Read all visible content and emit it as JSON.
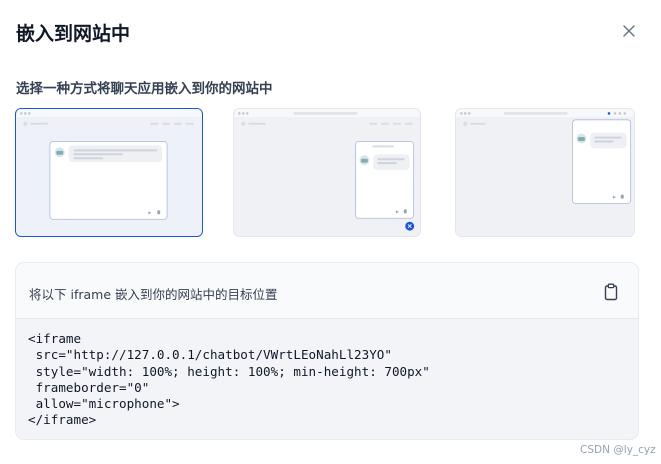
{
  "dialog": {
    "title": "嵌入到网站中",
    "subtitle": "选择一种方式将聊天应用嵌入到你的网站中"
  },
  "embed_options": [
    {
      "label": "iframe-full",
      "selected": true
    },
    {
      "label": "floating-bubble",
      "selected": false
    },
    {
      "label": "sidebar-popup",
      "selected": false
    }
  ],
  "code_panel": {
    "label": "将以下 iframe 嵌入到你的网站中的目标位置",
    "lines": [
      "<iframe",
      " src=\"http://127.0.0.1/chatbot/VWrtLEoNahLl23YO\"",
      " style=\"width: 100%; height: 100%; min-height: 700px\"",
      " frameborder=\"0\"",
      " allow=\"microphone\">",
      "</iframe>"
    ]
  },
  "watermark": "CSDN @ly_cyz",
  "colors": {
    "accent": "#1a56db",
    "selected_border": "#1a56db",
    "panel_bg": "#f2f4f7"
  },
  "icons": {
    "close": "close-icon",
    "copy": "clipboard-icon"
  }
}
